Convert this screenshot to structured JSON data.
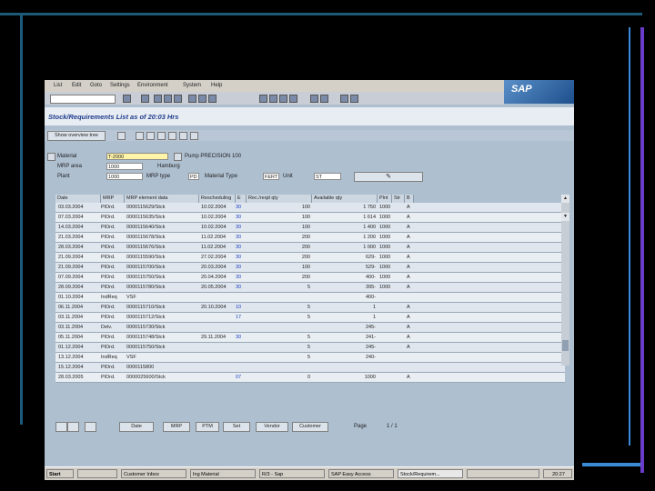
{
  "window": {
    "menu": [
      "List",
      "Edit",
      "Goto",
      "Settings",
      "Environment",
      "System",
      "Help"
    ],
    "logo": "SAP",
    "title": "Stock/Requirements List as of 20:03 Hrs"
  },
  "apptoolbar": {
    "show_overview": "Show overview tree"
  },
  "header": {
    "material_label": "Material",
    "material_value": "T-2000",
    "material_desc": "Pump PRECISION 100",
    "mrp_area_label": "MRP area",
    "mrp_area_value": "1000",
    "mrp_area_desc": "Hamburg",
    "plant_label": "Plant",
    "plant_value": "1000",
    "mrp_type_label": "MRP type",
    "mrp_type_value": "PD",
    "material_type_label": "Material Type",
    "material_type_value": "FERT",
    "unit_label": "Unit",
    "unit_value": "ST"
  },
  "grid": {
    "columns": [
      "Date",
      "MRP",
      "MRP element data",
      "Rescheduling",
      "E",
      "Rec./reqd qty",
      "Available qty",
      "Plnt",
      "Str",
      "B"
    ],
    "rows": [
      [
        "03.03.2004",
        "PlOrd.",
        "0000115629/Stck",
        "10.02.2004",
        "30",
        "100",
        "1 750",
        "1000",
        "A"
      ],
      [
        "07.03.2004",
        "PlOrd.",
        "0000115635/Stck",
        "10.02.2004",
        "30",
        "100",
        "1 614",
        "1000",
        "A"
      ],
      [
        "14.03.2004",
        "PlOrd.",
        "0000115640/Stck",
        "10.02.2004",
        "30",
        "100",
        "1 400",
        "1000",
        "A"
      ],
      [
        "21.03.2004",
        "PlOrd.",
        "0000115678/Stck",
        "11.02.2004",
        "30",
        "200",
        "1 200",
        "1000",
        "A"
      ],
      [
        "28.03.2004",
        "PlOrd.",
        "0000115676/Stck",
        "11.02.2004",
        "30",
        "200",
        "1 000",
        "1000",
        "A"
      ],
      [
        "21.09.2004",
        "PlOrd.",
        "0000115590/Stck",
        "27.02.2004",
        "30",
        "200",
        "629-",
        "1000",
        "A"
      ],
      [
        "21.09.2004",
        "PlOrd.",
        "0000115700/Stck",
        "20.03.2004",
        "30",
        "100",
        "529-",
        "1000",
        "A"
      ],
      [
        "07.09.2004",
        "PlOrd.",
        "0000115750/Stck",
        "20.04.2004",
        "30",
        "200",
        "400-",
        "1000",
        "A"
      ],
      [
        "28.09.2004",
        "PlOrd.",
        "0000115780/Stck",
        "20.05.2004",
        "30",
        "5",
        "395-",
        "1000",
        "A"
      ],
      [
        "01.10.2004",
        "IndReq",
        "VSF",
        "",
        "",
        "",
        "400-",
        "",
        ""
      ],
      [
        "06.11.2004",
        "PlOrd.",
        "0000115710/Stck",
        "20.10.2004",
        "10",
        "5",
        "1",
        "",
        "A"
      ],
      [
        "03.11.2004",
        "PlOrd.",
        "0000115712/Stck",
        "",
        "17",
        "5",
        "1",
        "",
        "A"
      ],
      [
        "03.11.2004",
        "Delv.",
        "0000115730/Stck",
        "",
        "",
        "",
        "245-",
        "",
        "A"
      ],
      [
        "05.11.2004",
        "PlOrd.",
        "0000115748/Stck",
        "29.11.2004",
        "30",
        "5",
        "241-",
        "",
        "A"
      ],
      [
        "01.12.2004",
        "PlOrd.",
        "0000115750/Stck",
        "",
        "",
        "5",
        "245-",
        "",
        "A"
      ],
      [
        "13.12.2004",
        "IndReq",
        "VSF",
        "",
        "",
        "5",
        "240-",
        "",
        ""
      ],
      [
        "15.12.2004",
        "PlOrd.",
        "0000115800",
        "",
        "",
        "",
        "",
        "",
        ""
      ],
      [
        "28.03.2005",
        "PlOrd.",
        "0000025600/Stck",
        "",
        "07",
        "0",
        "1000",
        "",
        "A"
      ]
    ]
  },
  "bottom": {
    "btn_date": "Date",
    "btn_mrp": "MRP",
    "btn_ptm": "PTM",
    "btn_set": "Set",
    "btn_vendor": "Vendor",
    "btn_customer": "Customer",
    "page_label": "Page",
    "page_value": "1 / 1"
  },
  "taskbar": {
    "start": "Start",
    "tasks": [
      "Customer Inbox",
      "Ing Material",
      "R/3 - Sap",
      "SAP Easy Access",
      "Stock/Requirem..."
    ],
    "clock": "20:27"
  }
}
